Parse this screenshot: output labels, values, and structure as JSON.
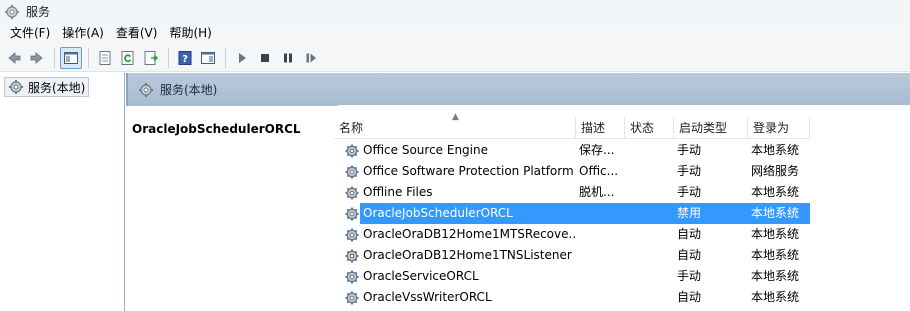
{
  "window": {
    "title": "服务"
  },
  "menu": {
    "items": [
      "文件(F)",
      "操作(A)",
      "查看(V)",
      "帮助(H)"
    ]
  },
  "tree": {
    "root_label": "服务(本地)"
  },
  "content": {
    "header": "服务(本地)",
    "selected_service_name": "OracleJobSchedulerORCL"
  },
  "list": {
    "columns": {
      "name": "名称",
      "desc": "描述",
      "status": "状态",
      "startup": "启动类型",
      "logon": "登录为"
    },
    "rows": [
      {
        "name": "Office  Source Engine",
        "desc": "保存...",
        "status": "",
        "startup": "手动",
        "logon": "本地系统"
      },
      {
        "name": "Office Software Protection Platform",
        "desc": "Offic...",
        "status": "",
        "startup": "手动",
        "logon": "网络服务"
      },
      {
        "name": "Offline Files",
        "desc": "脱机...",
        "status": "",
        "startup": "手动",
        "logon": "本地系统"
      },
      {
        "name": "OracleJobSchedulerORCL",
        "desc": "",
        "status": "",
        "startup": "禁用",
        "logon": "本地系统",
        "selected": true
      },
      {
        "name": "OracleOraDB12Home1MTSRecove...",
        "desc": "",
        "status": "",
        "startup": "自动",
        "logon": "本地系统"
      },
      {
        "name": "OracleOraDB12Home1TNSListener",
        "desc": "",
        "status": "",
        "startup": "自动",
        "logon": "本地系统"
      },
      {
        "name": "OracleServiceORCL",
        "desc": "",
        "status": "",
        "startup": "手动",
        "logon": "本地系统"
      },
      {
        "name": "OracleVssWriterORCL",
        "desc": "",
        "status": "",
        "startup": "自动",
        "logon": "本地系统"
      }
    ]
  },
  "colors": {
    "selection": "#3399ff",
    "header_band": "#b2c4da"
  },
  "icons": [
    "services-gear-icon",
    "back-arrow-icon",
    "forward-arrow-icon",
    "console-tree-icon",
    "properties-icon",
    "refresh-icon",
    "export-list-icon",
    "help-icon",
    "action-pane-icon",
    "play-icon",
    "stop-icon",
    "pause-icon",
    "resume-icon"
  ]
}
